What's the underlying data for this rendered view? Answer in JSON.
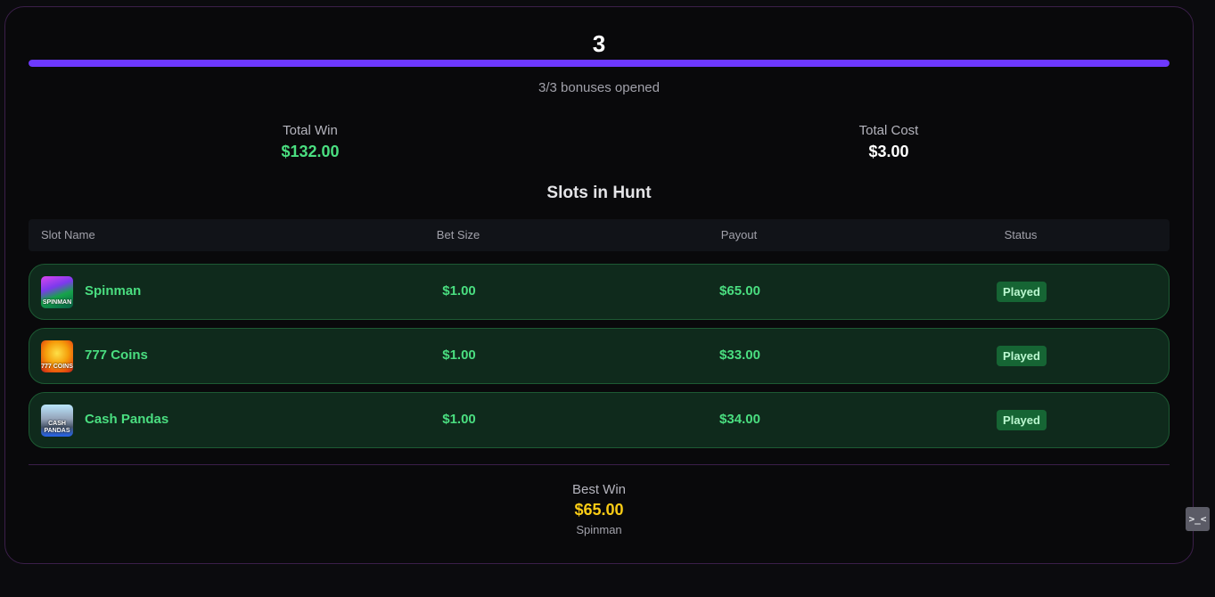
{
  "hunt": {
    "count": "3",
    "progress": 1.0,
    "opened_text": "3/3 bonuses opened",
    "total_win_label": "Total Win",
    "total_win_value": "$132.00",
    "total_cost_label": "Total Cost",
    "total_cost_value": "$3.00"
  },
  "table": {
    "title": "Slots in Hunt",
    "headers": [
      "Slot Name",
      "Bet Size",
      "Payout",
      "Status"
    ],
    "rows": [
      {
        "name": "Spinman",
        "thumb_text": "SPINMAN",
        "bet": "$1.00",
        "payout": "$65.00",
        "status": "Played"
      },
      {
        "name": "777 Coins",
        "thumb_text": "777 COINS",
        "bet": "$1.00",
        "payout": "$33.00",
        "status": "Played"
      },
      {
        "name": "Cash Pandas",
        "thumb_text": "CASH PANDAS",
        "bet": "$1.00",
        "payout": "$34.00",
        "status": "Played"
      }
    ]
  },
  "best_win": {
    "label": "Best Win",
    "value": "$65.00",
    "slot": "Spinman"
  },
  "side_toggle": {
    "glyph": ">_<",
    "icon": "collapse-toggle-icon"
  },
  "colors": {
    "accent": "#6d38ff",
    "win_green": "#4ade80",
    "best_win_gold": "#facc15",
    "row_bg": "#0f2a1c",
    "badge_bg": "#166534"
  }
}
